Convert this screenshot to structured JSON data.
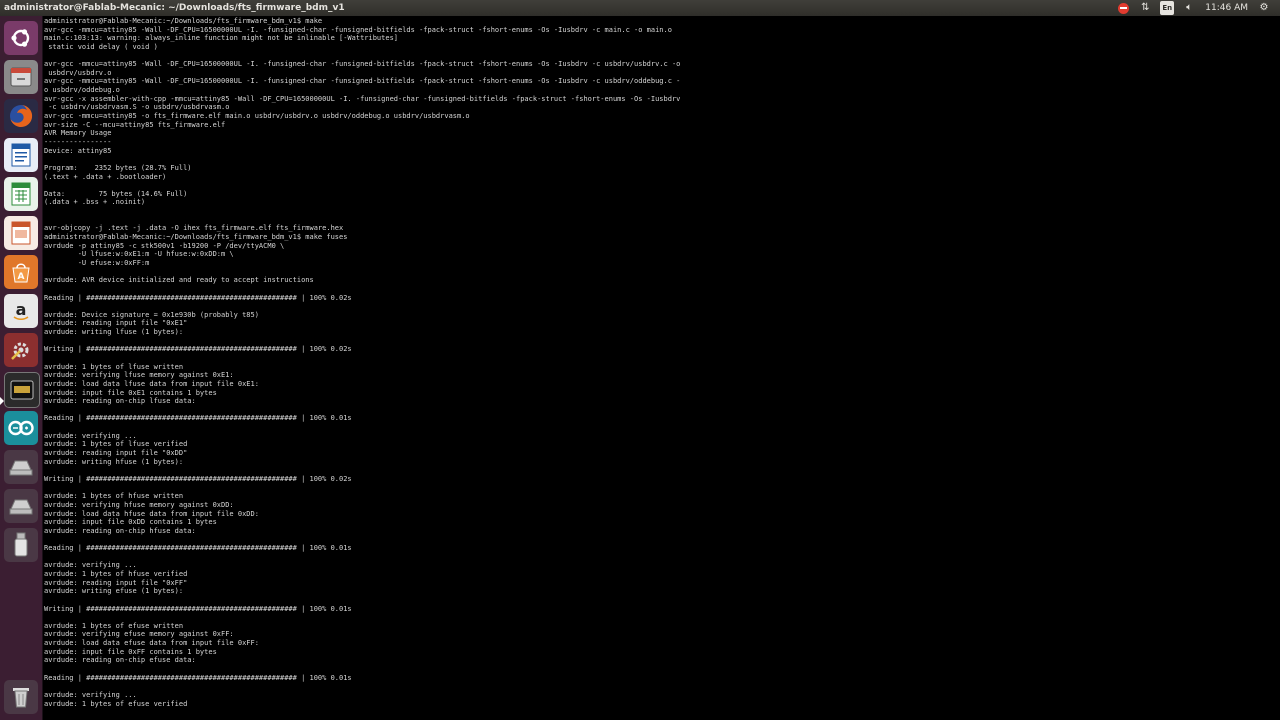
{
  "window": {
    "title": "administrator@Fablab-Mecanic: ~/Downloads/fts_firmware_bdm_v1"
  },
  "panel": {
    "keyboard_layout": "En",
    "clock": "11:46 AM"
  },
  "launcher": {
    "items": [
      {
        "name": "ubuntu-dash",
        "icon": "ubuntu-logo-icon",
        "color": "#7a3b69"
      },
      {
        "name": "files",
        "icon": "file-cabinet-icon",
        "color": "#8a8a8a"
      },
      {
        "name": "firefox",
        "icon": "firefox-icon",
        "color": "#e8641b"
      },
      {
        "name": "writer",
        "icon": "writer-doc-icon",
        "color": "#1f5aa6"
      },
      {
        "name": "calc",
        "icon": "calc-sheet-icon",
        "color": "#2d8c3b"
      },
      {
        "name": "impress",
        "icon": "impress-slide-icon",
        "color": "#c9552b"
      },
      {
        "name": "software-center",
        "icon": "software-center-icon",
        "color": "#e0772a"
      },
      {
        "name": "amazon",
        "icon": "amazon-icon",
        "color": "#e8e8e8"
      },
      {
        "name": "system-settings",
        "icon": "settings-tools-icon",
        "color": "#8c2f2f"
      },
      {
        "name": "terminal",
        "icon": "terminal-icon",
        "label": "TERM",
        "color": "#2b2b2b"
      },
      {
        "name": "arduino",
        "icon": "arduino-icon",
        "color": "#1b8f9c"
      },
      {
        "name": "drive-1",
        "icon": "drive-icon",
        "color": "#9a9a9a"
      },
      {
        "name": "drive-2",
        "icon": "drive-icon",
        "color": "#9a9a9a"
      },
      {
        "name": "usb-drive",
        "icon": "usb-stick-icon",
        "color": "#9a9a9a"
      },
      {
        "name": "trash",
        "icon": "trash-icon",
        "color": "#9a9a9a"
      }
    ]
  },
  "terminal": {
    "lines": [
      "administrator@Fablab-Mecanic:~/Downloads/fts_firmware_bdm_v1$ make",
      "avr-gcc -mmcu=attiny85 -Wall -DF_CPU=16500000UL -I. -funsigned-char -funsigned-bitfields -fpack-struct -fshort-enums -Os -Iusbdrv -c main.c -o main.o",
      "main.c:103:13: warning: always_inline function might not be inlinable [-Wattributes]",
      " static void delay ( void )",
      "",
      "avr-gcc -mmcu=attiny85 -Wall -DF_CPU=16500000UL -I. -funsigned-char -funsigned-bitfields -fpack-struct -fshort-enums -Os -Iusbdrv -c usbdrv/usbdrv.c -o",
      " usbdrv/usbdrv.o",
      "avr-gcc -mmcu=attiny85 -Wall -DF_CPU=16500000UL -I. -funsigned-char -funsigned-bitfields -fpack-struct -fshort-enums -Os -Iusbdrv -c usbdrv/oddebug.c -",
      "o usbdrv/oddebug.o",
      "avr-gcc -x assembler-with-cpp -mmcu=attiny85 -Wall -DF_CPU=16500000UL -I. -funsigned-char -funsigned-bitfields -fpack-struct -fshort-enums -Os -Iusbdrv",
      " -c usbdrv/usbdrvasm.S -o usbdrv/usbdrvasm.o",
      "avr-gcc -mmcu=attiny85 -o fts_firmware.elf main.o usbdrv/usbdrv.o usbdrv/oddebug.o usbdrv/usbdrvasm.o",
      "avr-size -C --mcu=attiny85 fts_firmware.elf",
      "AVR Memory Usage",
      "----------------",
      "Device: attiny85",
      "",
      "Program:    2352 bytes (28.7% Full)",
      "(.text + .data + .bootloader)",
      "",
      "Data:        75 bytes (14.6% Full)",
      "(.data + .bss + .noinit)",
      "",
      "",
      "avr-objcopy -j .text -j .data -O ihex fts_firmware.elf fts_firmware.hex",
      "administrator@Fablab-Mecanic:~/Downloads/fts_firmware_bdm_v1$ make fuses",
      "avrdude -p attiny85 -c stk500v1 -b19200 -P /dev/ttyACM0 \\",
      "        -U lfuse:w:0xE1:m -U hfuse:w:0xDD:m \\",
      "        -U efuse:w:0xFF:m",
      "",
      "avrdude: AVR device initialized and ready to accept instructions",
      "",
      "Reading | ################################################## | 100% 0.02s",
      "",
      "avrdude: Device signature = 0x1e930b (probably t85)",
      "avrdude: reading input file \"0xE1\"",
      "avrdude: writing lfuse (1 bytes):",
      "",
      "Writing | ################################################## | 100% 0.02s",
      "",
      "avrdude: 1 bytes of lfuse written",
      "avrdude: verifying lfuse memory against 0xE1:",
      "avrdude: load data lfuse data from input file 0xE1:",
      "avrdude: input file 0xE1 contains 1 bytes",
      "avrdude: reading on-chip lfuse data:",
      "",
      "Reading | ################################################## | 100% 0.01s",
      "",
      "avrdude: verifying ...",
      "avrdude: 1 bytes of lfuse verified",
      "avrdude: reading input file \"0xDD\"",
      "avrdude: writing hfuse (1 bytes):",
      "",
      "Writing | ################################################## | 100% 0.02s",
      "",
      "avrdude: 1 bytes of hfuse written",
      "avrdude: verifying hfuse memory against 0xDD:",
      "avrdude: load data hfuse data from input file 0xDD:",
      "avrdude: input file 0xDD contains 1 bytes",
      "avrdude: reading on-chip hfuse data:",
      "",
      "Reading | ################################################## | 100% 0.01s",
      "",
      "avrdude: verifying ...",
      "avrdude: 1 bytes of hfuse verified",
      "avrdude: reading input file \"0xFF\"",
      "avrdude: writing efuse (1 bytes):",
      "",
      "Writing | ################################################## | 100% 0.01s",
      "",
      "avrdude: 1 bytes of efuse written",
      "avrdude: verifying efuse memory against 0xFF:",
      "avrdude: load data efuse data from input file 0xFF:",
      "avrdude: input file 0xFF contains 1 bytes",
      "avrdude: reading on-chip efuse data:",
      "",
      "Reading | ################################################## | 100% 0.01s",
      "",
      "avrdude: verifying ...",
      "avrdude: 1 bytes of efuse verified"
    ]
  }
}
